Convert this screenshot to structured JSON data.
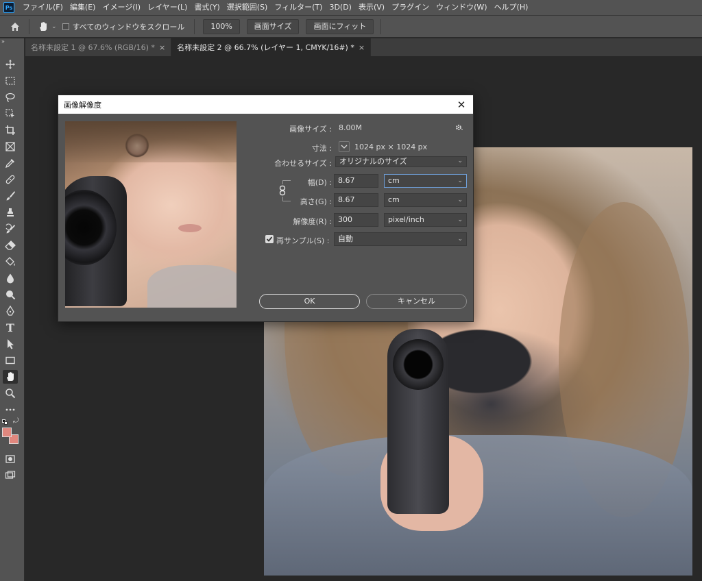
{
  "app": {
    "logo": "Ps"
  },
  "menu": [
    "ファイル(F)",
    "編集(E)",
    "イメージ(I)",
    "レイヤー(L)",
    "書式(Y)",
    "選択範囲(S)",
    "フィルター(T)",
    "3D(D)",
    "表示(V)",
    "プラグイン",
    "ウィンドウ(W)",
    "ヘルプ(H)"
  ],
  "options": {
    "scroll_all_label": "すべてのウィンドウをスクロール",
    "zoom_100": "100%",
    "screen_size": "画面サイズ",
    "fit_screen": "画面にフィット"
  },
  "tabs": [
    {
      "label": "名称未設定 1 @ 67.6% (RGB/16) *",
      "close": "×"
    },
    {
      "label": "名称未設定 2 @ 66.7% (レイヤー 1, CMYK/16#) *",
      "close": "×"
    }
  ],
  "toolbar": {
    "collapse": "»",
    "tools": [
      "move-icon",
      "marquee-icon",
      "lasso-icon",
      "object-select-icon",
      "crop-icon",
      "frame-icon",
      "eyedropper-icon",
      "healing-icon",
      "brush-icon",
      "stamp-icon",
      "history-brush-icon",
      "eraser-icon",
      "paint-bucket-icon",
      "blur-icon",
      "dodge-icon",
      "pen-icon",
      "type-icon",
      "path-select-icon",
      "rectangle-icon",
      "hand-icon",
      "zoom-icon",
      "more-icon"
    ],
    "active": "hand-icon",
    "text_tool_glyph": "T",
    "fg_color": "#e0877e",
    "bg_color": "#e0877e"
  },
  "dialog": {
    "title": "画像解像度",
    "close": "✕",
    "image_size_label": "画像サイズ :",
    "image_size_value": "8.00M",
    "dimensions_label": "寸法 :",
    "dimensions_value": "1024 px × 1024 px",
    "fit_to_label": "合わせるサイズ :",
    "fit_to_value": "オリジナルのサイズ",
    "width_label": "幅(D) :",
    "width_value": "8.67",
    "width_unit": "cm",
    "height_label": "高さ(G) :",
    "height_value": "8.67",
    "height_unit": "cm",
    "resolution_label": "解像度(R) :",
    "resolution_value": "300",
    "resolution_unit": "pixel/inch",
    "resample_label": "再サンプル(S) :",
    "resample_value": "自動",
    "ok": "OK",
    "cancel": "キャンセル",
    "chevron": "⌄"
  }
}
